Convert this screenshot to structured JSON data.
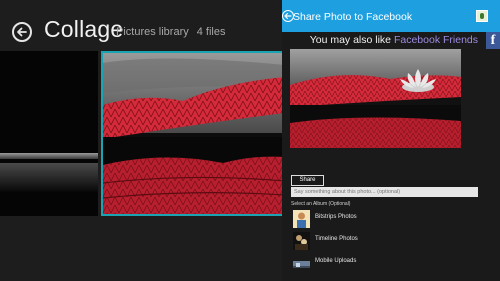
{
  "app": {
    "title": "Collage",
    "subtitle_location": "Pictures library",
    "subtitle_count": "4 files"
  },
  "share": {
    "title": "Share Photo to Facebook",
    "also_like_prefix": "You may also like",
    "also_like_link": "Facebook Friends",
    "fb_glyph": "f",
    "share_button": "Share",
    "message_placeholder": "Say something about this photo... (optional)",
    "album_label": "Select an Album (Optional)",
    "albums": [
      {
        "name": "Bitstrips Photos",
        "icon": "bitstrips-thumb"
      },
      {
        "name": "Timeline Photos",
        "icon": "timeline-thumb"
      },
      {
        "name": "Mobile Uploads",
        "icon": "mobile-uploads-thumb"
      }
    ]
  },
  "colors": {
    "accent": "#1ea0e0",
    "selection": "#1aa3b0",
    "link": "#9f8ae0",
    "facebook": "#3b5998",
    "leaf_red": "#d42a3a"
  }
}
